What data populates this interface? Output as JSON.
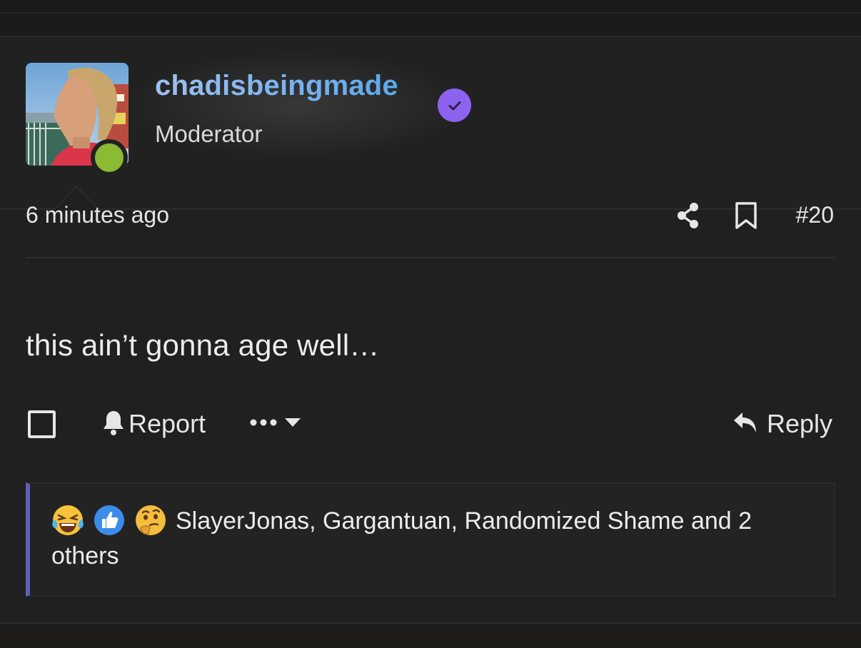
{
  "post": {
    "user": {
      "username": "chadisbeingmade",
      "title": "Moderator",
      "online": true,
      "verified": true
    },
    "meta": {
      "timestamp": "6 minutes ago",
      "post_number": "#20"
    },
    "body": "this ain’t gonna age well…",
    "actions": {
      "report_label": "Report",
      "more_label": "•••",
      "reply_label": "Reply"
    },
    "reactions": {
      "icons": [
        "laughing-crying-emoji",
        "thumbs-up-emoji",
        "thinking-emoji"
      ],
      "text": "SlayerJonas, Gargantuan, Randomized Shame and 2 others"
    }
  },
  "colors": {
    "background": "#1a1a1b",
    "post_background": "#202021",
    "username_gradient_start": "#9dc1ef",
    "username_gradient_end": "#5aa8ea",
    "verified_badge": "#8b63ee",
    "online_indicator": "#8bba33",
    "reaction_accent": "#5d5fb8"
  }
}
